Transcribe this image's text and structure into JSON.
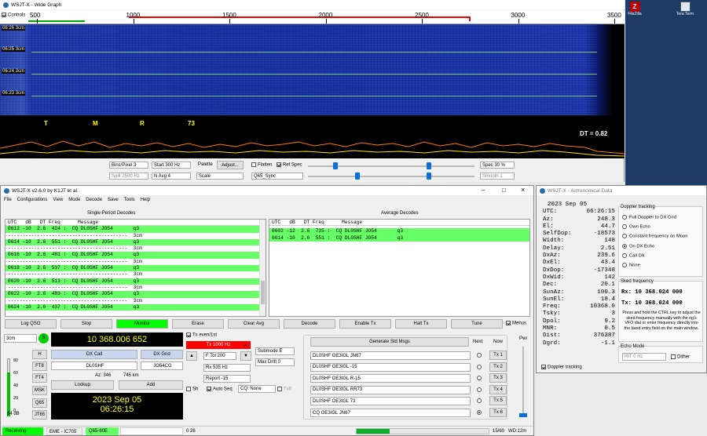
{
  "wide": {
    "title": "WSJT-X - Wide Graph",
    "controls_label": "Controls",
    "freq_ticks": [
      "500",
      "1000",
      "1500",
      "2000",
      "2500",
      "3000",
      "3500"
    ],
    "time_labels": [
      "06:26   3cm",
      "06:25   3cm",
      "06:24   3cm",
      "06:23   3cm"
    ],
    "markers": [
      "T",
      "M",
      "R",
      "73"
    ],
    "dt_label": "DT =  0.82",
    "bins_per_pixel": "Bins/Pixel  3",
    "start": "Start  300 Hz",
    "split": "Split  2500 Hz",
    "navg": "N Avg  4",
    "palette_label": "Palette",
    "adjust": "Adjust...",
    "scale": "Scale",
    "flatten": "Flatten",
    "ref_spec": "Ref Spec",
    "q65_sync": "Q65_Sync",
    "spec": "Spec  30 %",
    "smooth": "Smooth  1"
  },
  "desktop": {
    "icon1": "FileZilla",
    "icon2": "Tera Term"
  },
  "main": {
    "title": "WSJT-X   v2.6.0   by K1JT et al.",
    "menu": [
      "File",
      "Configurations",
      "View",
      "Mode",
      "Decode",
      "Save",
      "Tools",
      "Help"
    ],
    "single_header": "Single-Period Decodes",
    "avg_header": "Average Decodes",
    "col_header": "UTC   dB   DT Freq      Message",
    "single_rows": [
      {
        "t": "0612 -10  2.6  424 :  CQ DL0SHF JO54       q3",
        "c": "g"
      },
      {
        "t": "-----------------------------------------  3cm",
        "c": "sep"
      },
      {
        "t": "0614 -10  2.6  551 :  CQ DL0SHF JO54       q3",
        "c": "g"
      },
      {
        "t": "-----------------------------------------  3cm",
        "c": "sep"
      },
      {
        "t": "0616 -10  2.6  481 :  CQ DL0SHF JO54       q3",
        "c": "g"
      },
      {
        "t": "-----------------------------------------  3cm",
        "c": "sep"
      },
      {
        "t": "0618 -10  2.6  537 :  CQ DL0SHF JO54       q3",
        "c": "g"
      },
      {
        "t": "-----------------------------------------  3cm",
        "c": "sep"
      },
      {
        "t": "0620 -10  2.6  513 :  CQ DL0SHF JO54       q3",
        "c": "g"
      },
      {
        "t": "-----------------------------------------  3cm",
        "c": "sep"
      },
      {
        "t": "0622 -10  2.6  483 :  CQ DL0SHF JO54       q3",
        "c": "g"
      },
      {
        "t": "-----------------------------------------  3cm",
        "c": "sep"
      },
      {
        "t": "0624 -10  2.6  437 :  CQ DL0SHF JO54       q3",
        "c": "g"
      }
    ],
    "avg_rows": [
      "0602 -12  2.6  735 :  CQ DL0SHF JO54       q3",
      "0614 -10  2.6  551 :  CQ DL0SHF JO54       q3"
    ],
    "buttons": {
      "log": "Log QSO",
      "stop": "Stop",
      "monitor": "Monitor",
      "erase": "Erase",
      "clear_avg": "Clear Avg",
      "decode": "Decode",
      "enable_tx": "Enable Tx",
      "halt_tx": "Halt Tx",
      "tune": "Tune",
      "menus": "Menus"
    },
    "band": "3cm",
    "freq": "10 368.006 652",
    "mode_buttons": [
      "H",
      "FT8",
      "FT4",
      "MSK",
      "Q65",
      "JT65"
    ],
    "dx_call_label": "DX Call",
    "dx_grid_label": "DX Grid",
    "dx_call": "DL0SHF",
    "dx_grid": "JO54CG",
    "az": "Az: 346",
    "dist": "745 km",
    "lookup": "Lookup",
    "add": "Add",
    "date": "2023 Sep 05",
    "time": "06:26:15",
    "tx_even": "Tx even/1st",
    "tx_freq": "Tx 1000 Hz",
    "ftol": "F Tol  200",
    "rx_freq": "Rx  535 Hz",
    "report": "Report -15",
    "submode": "Submode E",
    "max_drift": "Max Drift  0",
    "sh": "Sh",
    "auto_seq": "Auto Seq",
    "cq_none": "CQ: None",
    "tx6_chk": "Tx6",
    "gen_std": "Generate Std Msgs",
    "next_label": "Next",
    "now_label": "Now",
    "pwr": "Pwr",
    "tx_msgs": [
      "DL0SHF OE3IGL JN67",
      "DL0SHF OE3IGL -15",
      "DL0SHF OE3IGL R-15",
      "DL0SHF OE3IGL RR73",
      "DL0SHF OE3IGL 73",
      "CQ OE3IGL JN67"
    ],
    "tx_btns": [
      "Tx 1",
      "Tx 2",
      "Tx 3",
      "Tx 4",
      "Tx 5",
      "Tx 6"
    ],
    "meter_ticks": [
      "80",
      "60",
      "40",
      "20",
      "0"
    ],
    "meter_db": "64 dB",
    "status": {
      "receiving": "Receiving",
      "rig": "EME - IC705",
      "mode": "Q65-60E",
      "count": "0  26",
      "period": "15/60",
      "wd": "WD:12m"
    }
  },
  "astro": {
    "title": "WSJT-X - Astronomical Data",
    "date": "2023 Sep 05",
    "rows": [
      [
        "UTC:",
        "06:26:15"
      ],
      [
        "Az:",
        "248.3"
      ],
      [
        "El:",
        "44.7"
      ],
      [
        "SelfDop:",
        "-18573"
      ],
      [
        "Width:",
        "148"
      ],
      [
        "Delay:",
        "2.51"
      ],
      [
        "DxAz:",
        "239.6"
      ],
      [
        "DxEl:",
        "43.4"
      ],
      [
        "DxDop:",
        "-17348"
      ],
      [
        "DxWid:",
        "142"
      ],
      [
        "Dec:",
        "20.1"
      ],
      [
        "SunAz:",
        "100.3"
      ],
      [
        "SunEl:",
        "18.4"
      ],
      [
        "Freq:",
        "10368.0"
      ],
      [
        "Tsky:",
        "3"
      ],
      [
        "Dpol:",
        "9.2"
      ],
      [
        "MNR:",
        "0.5"
      ],
      [
        "Dist:",
        "376387"
      ],
      [
        "Dgrd:",
        "-1.1"
      ]
    ],
    "doppler_label": "Doppler tracking",
    "doppler_opts": [
      "Full Doppler to DX Grid",
      "Own Echo",
      "Constant frequency on Moon",
      "On DX Echo",
      "Call DX",
      "None"
    ],
    "doppler_selected": 3,
    "sked_label": "Sked frequency",
    "rx": "Rx:  10 368.024 000",
    "tx": "Tx:  10 368.024 000",
    "help": "Press and hold the CTRL key to adjust the sked frequency manually with the rig's VFO dial or enter frequency directly into the band entry field on the main window.",
    "echo_label": "Echo Mode",
    "rit": "RIT  0 Hz",
    "dither": "Dither",
    "doppler_chk": "Doppler tracking"
  },
  "colors": {
    "waterfall": "#1433a6",
    "green": "#66ff66",
    "lcd": "#000000",
    "lcd_text": "#ffff00",
    "tx_red": "#ff0000"
  }
}
